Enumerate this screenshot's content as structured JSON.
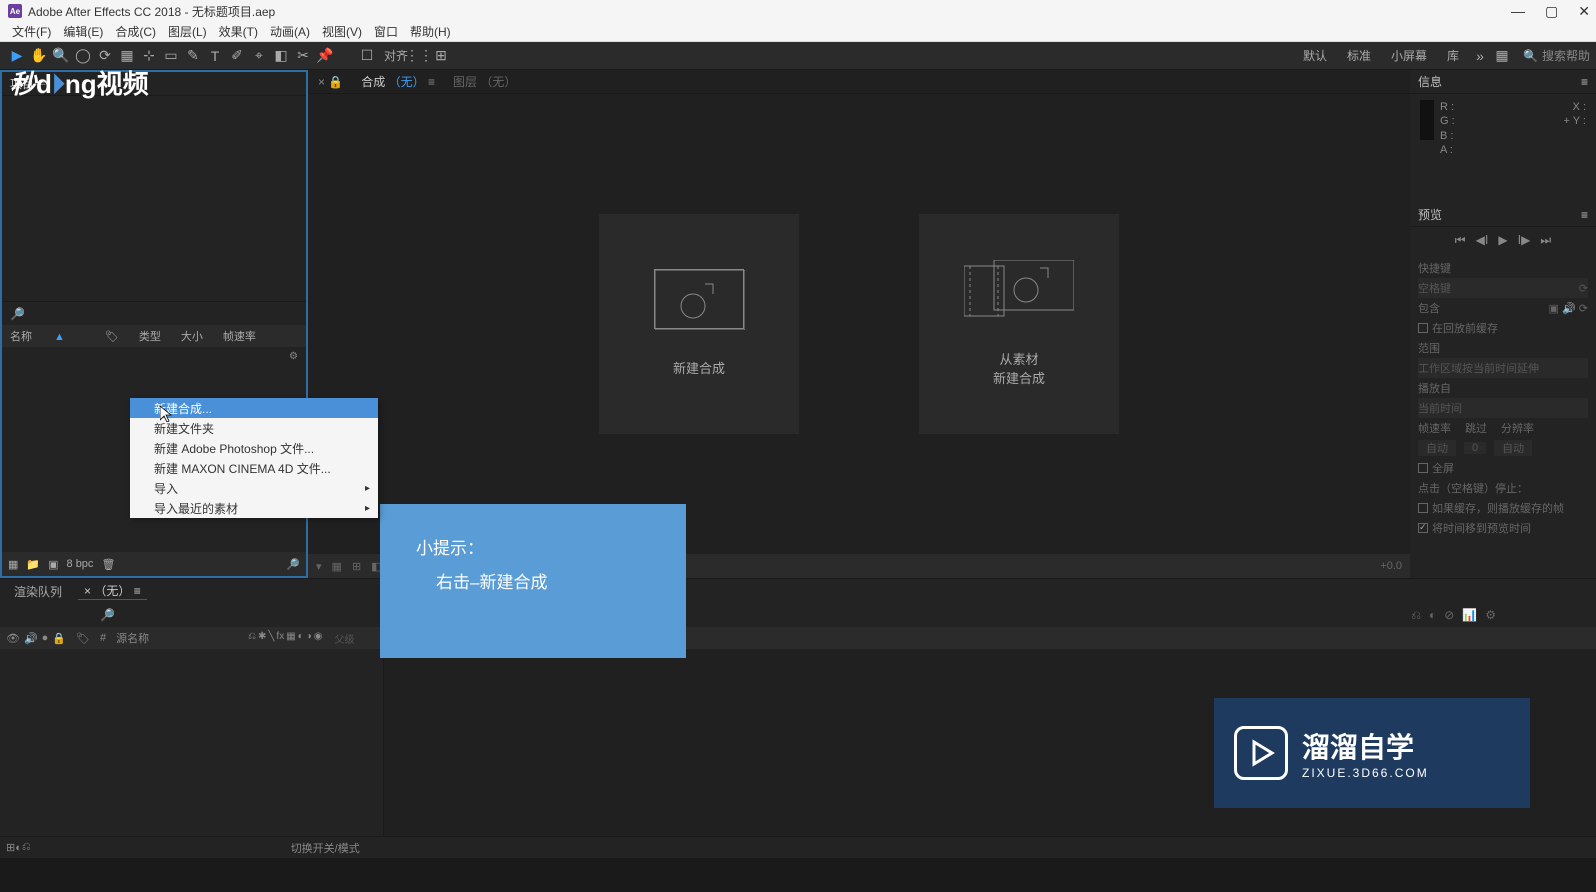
{
  "titlebar": {
    "app_icon_text": "Ae",
    "title": "Adobe After Effects CC 2018 - 无标题项目.aep"
  },
  "menubar": {
    "items": [
      "文件(F)",
      "编辑(E)",
      "合成(C)",
      "图层(L)",
      "效果(T)",
      "动画(A)",
      "视图(V)",
      "窗口",
      "帮助(H)"
    ]
  },
  "toolbar": {
    "align_label": "对齐",
    "workspaces": [
      "默认",
      "标准",
      "小屏幕",
      "库"
    ],
    "search_placeholder": "搜索帮助"
  },
  "project": {
    "tab_label": "项目",
    "cols": {
      "name": "名称",
      "type": "类型",
      "size": "大小",
      "fps": "帧速率"
    },
    "bpc": "8 bpc"
  },
  "comp": {
    "tab_prefix": "合成",
    "tab_value": "（无）",
    "layer_tab": "图层 （无）",
    "card1": "新建合成",
    "card2_line1": "从素材",
    "card2_line2": "新建合成",
    "zoom": "+0.0"
  },
  "info": {
    "title": "信息",
    "r": "R :",
    "g": "G :",
    "b": "B :",
    "a": "A :",
    "x": "X :",
    "y": "Y :"
  },
  "preview": {
    "title": "预览",
    "shortcut_label": "快捷键",
    "shortcut_value": "空格键",
    "include_label": "包含",
    "loop_label": "在回放前缓存",
    "range_label": "范围",
    "range_value": "工作区域按当前时间延伸",
    "playfrom_label": "播放自",
    "playfrom_value": "当前时间",
    "framerate": "帧速率",
    "skip": "跳过",
    "resolution": "分辨率",
    "auto": "自动",
    "skip_value": "0",
    "fullscreen": "全屏",
    "stop_label": "点击（空格键）停止：",
    "cache_label": "如果缓存，则播放缓存的帧",
    "movepreview_label": "将时间移到预览时间"
  },
  "timeline": {
    "render_queue": "渲染队列",
    "none_tab": "（无）",
    "src_name": "源名称",
    "switch_label": "切换开关/模式"
  },
  "context_menu": {
    "items": [
      {
        "label": "新建合成...",
        "sub": false,
        "highlight": true
      },
      {
        "label": "新建文件夹",
        "sub": false,
        "highlight": false
      },
      {
        "label": "新建 Adobe Photoshop 文件...",
        "sub": false,
        "highlight": false
      },
      {
        "label": "新建 MAXON CINEMA 4D 文件...",
        "sub": false,
        "highlight": false
      },
      {
        "label": "导入",
        "sub": true,
        "highlight": false
      },
      {
        "label": "导入最近的素材",
        "sub": true,
        "highlight": false
      }
    ]
  },
  "tooltip": {
    "line1": "小提示：",
    "line2": "右击–新建合成"
  },
  "watermark": "秒dong视频",
  "brlogo": {
    "text": "溜溜自学",
    "sub": "ZIXUE.3D66.COM"
  }
}
